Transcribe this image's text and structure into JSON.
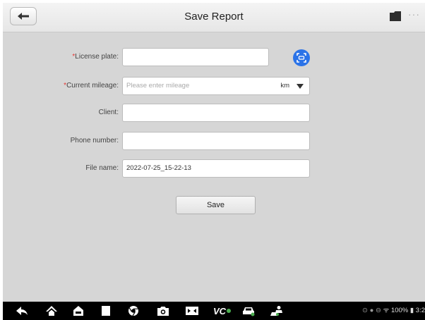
{
  "header": {
    "title": "Save Report"
  },
  "form": {
    "license_plate": {
      "required_mark": "*",
      "label": "License plate:",
      "value": ""
    },
    "current_mileage": {
      "required_mark": "*",
      "label": "Current mileage:",
      "placeholder": "Please enter mileage",
      "unit": "km"
    },
    "client": {
      "label": "Client:",
      "value": ""
    },
    "phone_number": {
      "label": "Phone number:",
      "value": ""
    },
    "file_name": {
      "label": "File name:",
      "value": "2022-07-25_15-22-13"
    }
  },
  "actions": {
    "save_label": "Save"
  },
  "navbar": {
    "icons": [
      "back-icon",
      "home-icon",
      "car-home-icon",
      "recent-apps-icon",
      "chrome-icon",
      "camera-icon",
      "screenshot-icon",
      "vci-icon",
      "vehicle-icon",
      "remote-support-icon"
    ],
    "vci_label": "VC",
    "status_text": "100%",
    "time": "3:2"
  },
  "colors": {
    "accent": "#2b73e8",
    "required": "#e53935",
    "background": "#d6d6d6",
    "navbar": "#000000"
  }
}
